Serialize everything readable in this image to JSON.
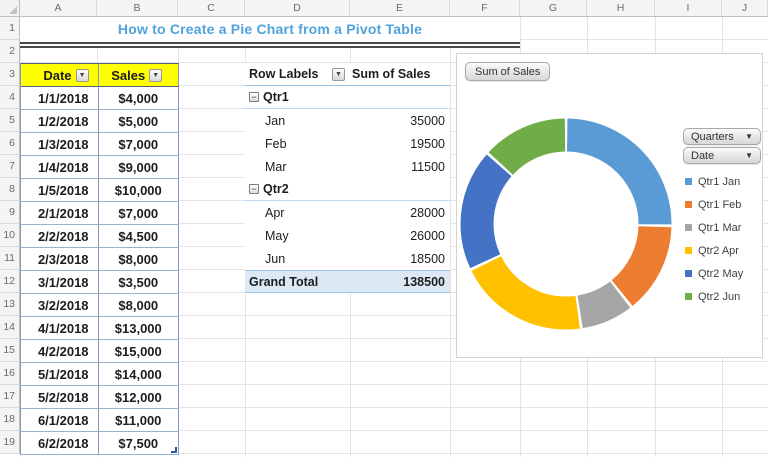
{
  "sheet": {
    "title": "How to Create a Pie Chart from a Pivot Table",
    "column_headers": [
      "A",
      "B",
      "C",
      "D",
      "E",
      "F",
      "G",
      "H",
      "I",
      "J"
    ],
    "row_headers": [
      "1",
      "2",
      "3",
      "4",
      "5",
      "6",
      "7",
      "8",
      "9",
      "10",
      "11",
      "12",
      "13",
      "14",
      "15",
      "16",
      "17",
      "18",
      "19"
    ]
  },
  "icons": {
    "dropdown": "▼",
    "axis_dropdown": "▼",
    "collapse": "−"
  },
  "data_table": {
    "headers": [
      "Date",
      "Sales"
    ],
    "rows": [
      [
        "1/1/2018",
        "$4,000"
      ],
      [
        "1/2/2018",
        "$5,000"
      ],
      [
        "1/3/2018",
        "$7,000"
      ],
      [
        "1/4/2018",
        "$9,000"
      ],
      [
        "1/5/2018",
        "$10,000"
      ],
      [
        "2/1/2018",
        "$7,000"
      ],
      [
        "2/2/2018",
        "$4,500"
      ],
      [
        "2/3/2018",
        "$8,000"
      ],
      [
        "3/1/2018",
        "$3,500"
      ],
      [
        "3/2/2018",
        "$8,000"
      ],
      [
        "4/1/2018",
        "$13,000"
      ],
      [
        "4/2/2018",
        "$15,000"
      ],
      [
        "5/1/2018",
        "$14,000"
      ],
      [
        "5/2/2018",
        "$12,000"
      ],
      [
        "6/1/2018",
        "$11,000"
      ],
      [
        "6/2/2018",
        "$7,500"
      ]
    ]
  },
  "pivot_table": {
    "header": {
      "row_labels": "Row Labels",
      "values": "Sum of Sales"
    },
    "rows": [
      {
        "type": "group",
        "label": "Qtr1",
        "value": ""
      },
      {
        "type": "item",
        "label": "Jan",
        "value": "35000"
      },
      {
        "type": "item",
        "label": "Feb",
        "value": "19500"
      },
      {
        "type": "item",
        "label": "Mar",
        "value": "11500"
      },
      {
        "type": "group",
        "label": "Qtr2",
        "value": ""
      },
      {
        "type": "item",
        "label": "Apr",
        "value": "28000"
      },
      {
        "type": "item",
        "label": "May",
        "value": "26000"
      },
      {
        "type": "item",
        "label": "Jun",
        "value": "18500"
      },
      {
        "type": "total",
        "label": "Grand Total",
        "value": "138500"
      }
    ]
  },
  "chart": {
    "value_field_button": "Sum of Sales",
    "axis_buttons": [
      "Quarters",
      "Date"
    ]
  },
  "chart_data": {
    "type": "pie",
    "subtype": "donut",
    "title": "Sum of Sales",
    "categories": [
      "Qtr1 Jan",
      "Qtr1 Feb",
      "Qtr1 Mar",
      "Qtr2 Apr",
      "Qtr2 May",
      "Qtr2 Jun"
    ],
    "values": [
      35000,
      19500,
      11500,
      28000,
      26000,
      18500
    ],
    "total": 138500,
    "colors": [
      "#5B9BD5",
      "#ED7D31",
      "#A5A5A5",
      "#FFC000",
      "#4472C4",
      "#70AD47"
    ],
    "hole_ratio": 0.7,
    "legend_position": "right",
    "data_labels": false
  },
  "colors": {
    "title_text": "#4FA3DC",
    "table_header_fill": "#FFFF00",
    "table_border": "#7f9db9",
    "pivot_border": "#9DC3E6",
    "pivot_total_fill": "#DCE8F4",
    "gridline": "#e4e4e4"
  }
}
